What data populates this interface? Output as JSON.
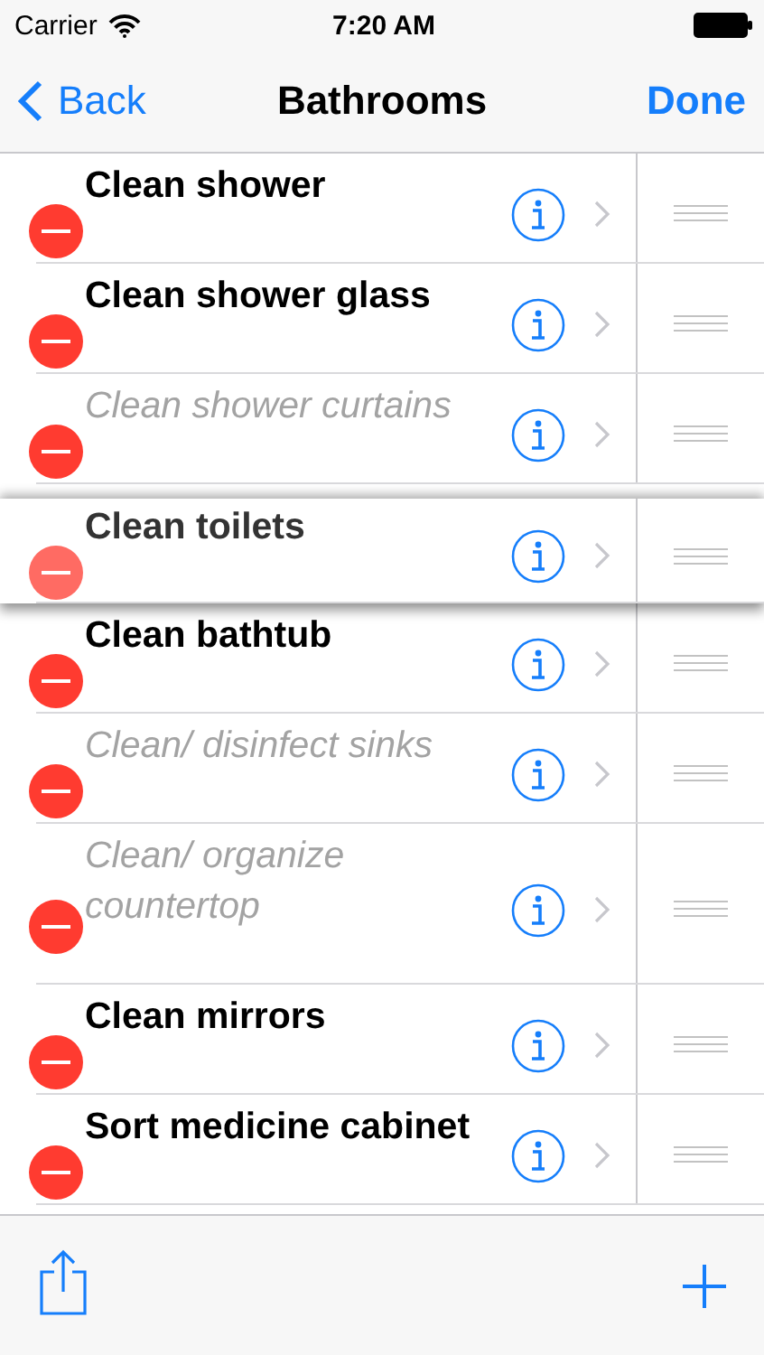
{
  "status_bar": {
    "carrier": "Carrier",
    "time": "7:20 AM"
  },
  "nav": {
    "back": "Back",
    "title": "Bathrooms",
    "done": "Done"
  },
  "items": [
    {
      "label": "Clean shower",
      "done": false,
      "dragging": false
    },
    {
      "label": "Clean shower glass",
      "done": false,
      "dragging": false
    },
    {
      "label": "Clean shower curtains",
      "done": true,
      "dragging": false
    },
    {
      "label": "Clean toilets",
      "done": false,
      "dragging": true
    },
    {
      "label": "Clean bathtub",
      "done": false,
      "dragging": false
    },
    {
      "label": "Clean/ disinfect sinks",
      "done": true,
      "dragging": false
    },
    {
      "label": "Clean/ organize countertop",
      "done": true,
      "dragging": false
    },
    {
      "label": "Clean mirrors",
      "done": false,
      "dragging": false
    },
    {
      "label": "Sort medicine cabinet",
      "done": false,
      "dragging": false
    }
  ]
}
